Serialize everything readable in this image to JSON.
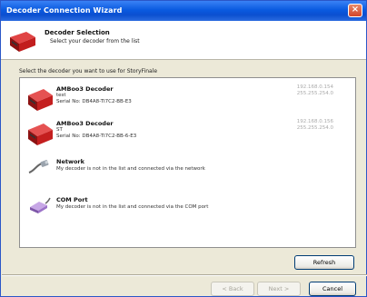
{
  "window": {
    "title": "Decoder Connection Wizard",
    "close_label": "×"
  },
  "header": {
    "title": "Decoder Selection",
    "subtitle": "Select your decoder from the list"
  },
  "instruction": "Select the decoder you want to use for StoryFinale",
  "decoders": [
    {
      "icon": "decoder-device-icon",
      "name": "AMBoo3 Decoder",
      "line1": "test",
      "line2": "Serial No: DB4A8-TI7C2-BB-E3",
      "ip": "192.168.0.154",
      "mask": "255.255.254.0"
    },
    {
      "icon": "decoder-device-icon",
      "name": "AMBoo3 Decoder",
      "line1": "ST",
      "line2": "Serial No: DB4A8-TI7C2-BB-6-E3",
      "ip": "192.168.0.156",
      "mask": "255.255.254.0"
    },
    {
      "icon": "network-cable-icon",
      "name": "Network",
      "line1": "My decoder is not in the list and connected via the network",
      "line2": "",
      "ip": "",
      "mask": ""
    },
    {
      "icon": "com-port-icon",
      "name": "COM Port",
      "line1": "My decoder is not in the list and connected via the COM port",
      "line2": "",
      "ip": "",
      "mask": ""
    }
  ],
  "buttons": {
    "refresh": "Refresh",
    "back": "< Back",
    "next": "Next >",
    "cancel": "Cancel"
  },
  "colors": {
    "accent_red": "#c91f1f",
    "titlebar_blue": "#0a5ae0"
  }
}
